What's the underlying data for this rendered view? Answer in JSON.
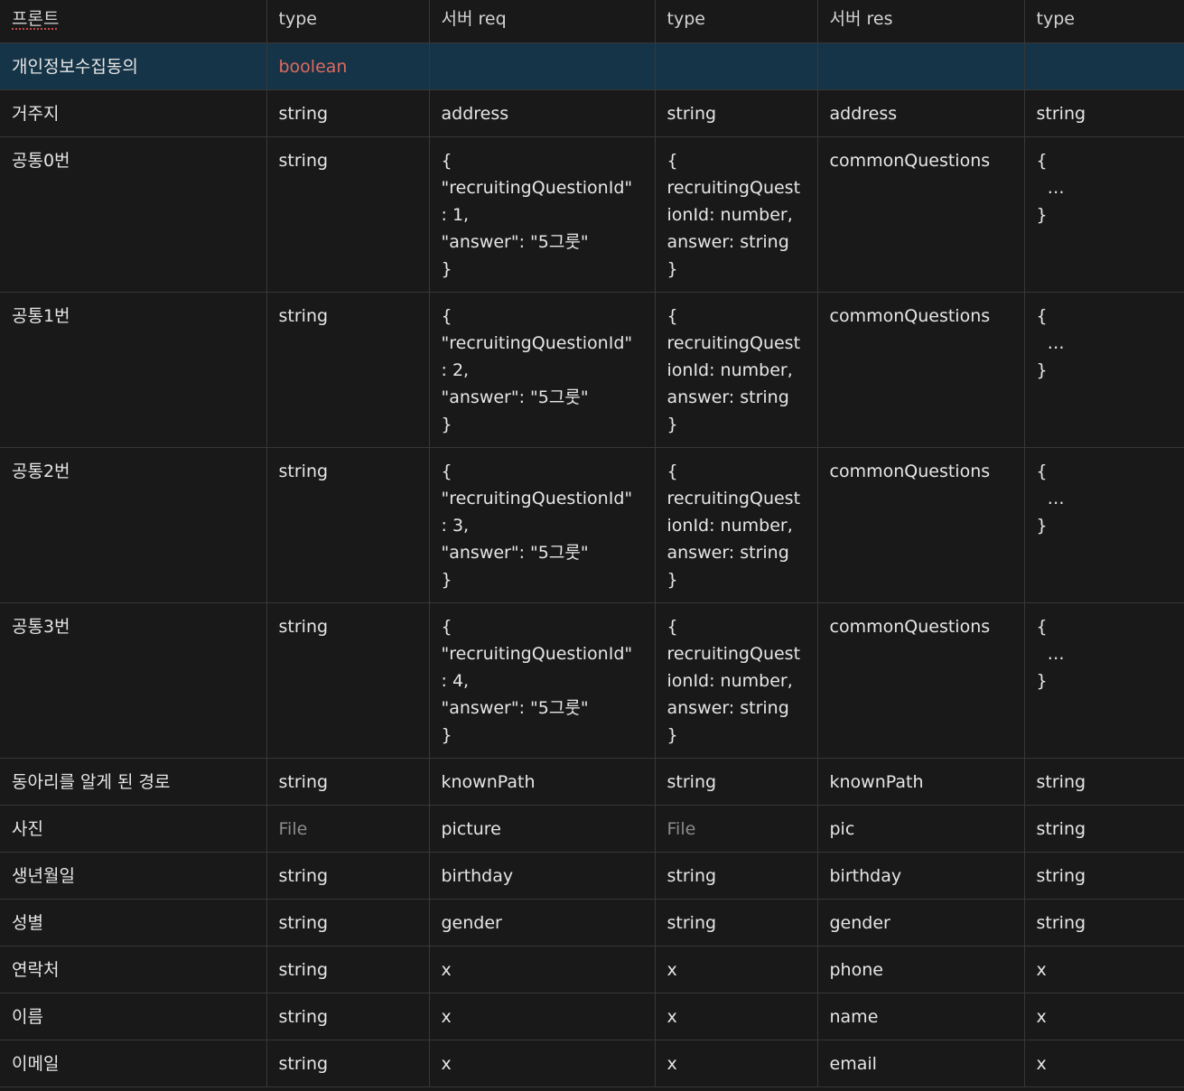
{
  "table": {
    "headers": [
      "프론트",
      "type",
      "서버 req",
      "type",
      "서버 res",
      "type"
    ],
    "rows": [
      {
        "front": "개인정보수집동의",
        "type": "boolean",
        "req": "",
        "req_type": "",
        "res": "",
        "res_type": ""
      },
      {
        "front": "거주지",
        "type": "string",
        "req": "address",
        "req_type": "string",
        "res": "address",
        "res_type": "string"
      },
      {
        "front": "공통0번",
        "type": "string",
        "req": "{\n\"recruitingQuestionId\"\n: 1,\n\"answer\": \"5그룻\"\n}",
        "req_type": "{\nrecruitingQuest\nionId: number,\nanswer: string\n}",
        "res": "commonQuestions",
        "res_type": "{\n  …\n}"
      },
      {
        "front": "공통1번",
        "type": "string",
        "req": "{\n\"recruitingQuestionId\"\n: 2,\n\"answer\": \"5그룻\"\n}",
        "req_type": "{\nrecruitingQuest\nionId: number,\nanswer: string\n}",
        "res": "commonQuestions",
        "res_type": "{\n  …\n}"
      },
      {
        "front": "공통2번",
        "type": "string",
        "req": "{\n\"recruitingQuestionId\"\n: 3,\n\"answer\": \"5그룻\"\n}",
        "req_type": "{\nrecruitingQuest\nionId: number,\nanswer: string\n}",
        "res": "commonQuestions",
        "res_type": "{\n  …\n}"
      },
      {
        "front": "공통3번",
        "type": "string",
        "req": "{\n\"recruitingQuestionId\"\n: 4,\n\"answer\": \"5그룻\"\n}",
        "req_type": "{\nrecruitingQuest\nionId: number,\nanswer: string\n}",
        "res": "commonQuestions",
        "res_type": "{\n  …\n}"
      },
      {
        "front": "동아리를 알게 된 경로",
        "type": "string",
        "req": "knownPath",
        "req_type": "string",
        "res": "knownPath",
        "res_type": "string"
      },
      {
        "front": "사진",
        "type": "File",
        "req": "picture",
        "req_type": "File",
        "res": "pic",
        "res_type": "string"
      },
      {
        "front": "생년월일",
        "type": "string",
        "req": "birthday",
        "req_type": "string",
        "res": "birthday",
        "res_type": "string"
      },
      {
        "front": "성별",
        "type": "string",
        "req": "gender",
        "req_type": "string",
        "res": "gender",
        "res_type": "string"
      },
      {
        "front": "연락처",
        "type": "string",
        "req": "x",
        "req_type": "x",
        "res": "phone",
        "res_type": "x"
      },
      {
        "front": "이름",
        "type": "string",
        "req": "x",
        "req_type": "x",
        "res": "name",
        "res_type": "x"
      },
      {
        "front": "이메일",
        "type": "string",
        "req": "x",
        "req_type": "x",
        "res": "email",
        "res_type": "x"
      }
    ]
  },
  "colors": {
    "background": "#191919",
    "selected_row": "#163447",
    "boolean_text": "#de6a5e",
    "dim_text": "#8b8b8b",
    "border": "#373737"
  }
}
